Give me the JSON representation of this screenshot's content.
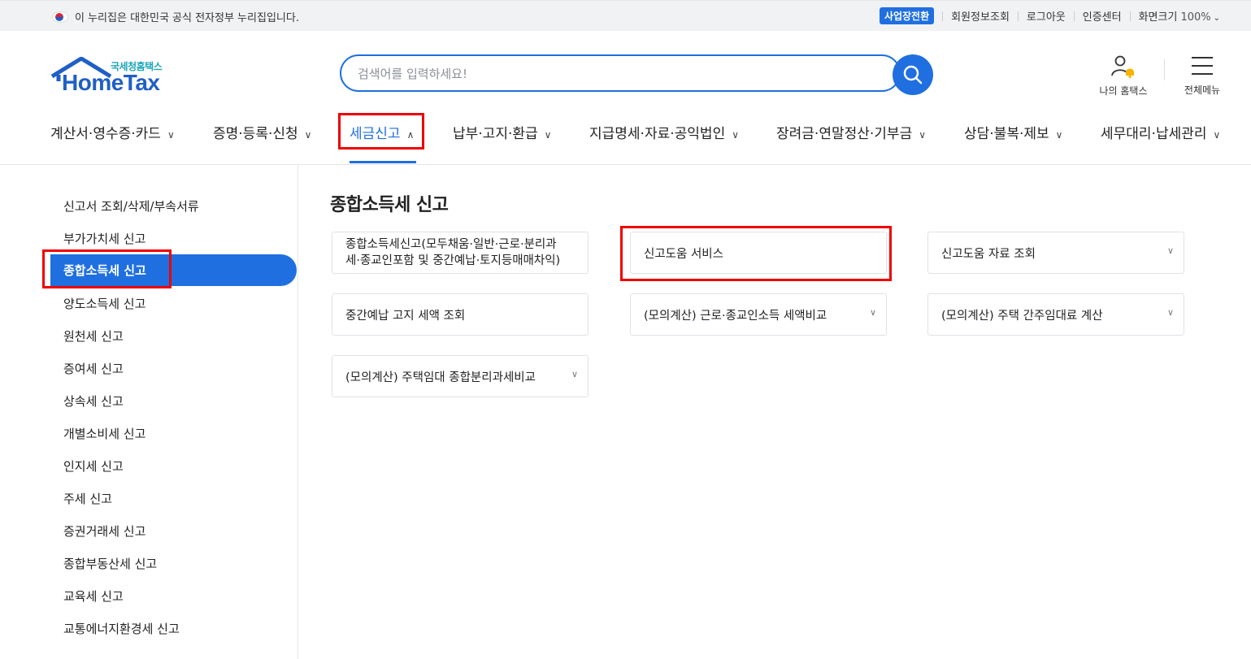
{
  "topbar": {
    "gov_text": "이 누리집은 대한민국 공식 전자정부 누리집입니다.",
    "biz_switch": "사업장전환",
    "member_info": "회원정보조회",
    "logout": "로그아웃",
    "cert_center": "인증센터",
    "zoom_label": "화면크기",
    "zoom_value": "100%"
  },
  "logo": {
    "korean": "국세청홈택스",
    "english": "HomeTax"
  },
  "search": {
    "placeholder": "검색어를 입력하세요!"
  },
  "header": {
    "my_hometax": "나의 홈택스",
    "all_menu": "전체메뉴"
  },
  "gnb": [
    {
      "label": "계산서·영수증·카드"
    },
    {
      "label": "증명·등록·신청"
    },
    {
      "label": "세금신고"
    },
    {
      "label": "납부·고지·환급"
    },
    {
      "label": "지급명세·자료·공익법인"
    },
    {
      "label": "장려금·연말정산·기부금"
    },
    {
      "label": "상담·불복·제보"
    },
    {
      "label": "세무대리·납세관리"
    }
  ],
  "sidebar": {
    "items": [
      {
        "label": "신고서 조회/삭제/부속서류"
      },
      {
        "label": "부가가치세 신고"
      },
      {
        "label": "종합소득세 신고"
      },
      {
        "label": "양도소득세 신고"
      },
      {
        "label": "원천세 신고"
      },
      {
        "label": "증여세 신고"
      },
      {
        "label": "상속세 신고"
      },
      {
        "label": "개별소비세 신고"
      },
      {
        "label": "인지세 신고"
      },
      {
        "label": "주세 신고"
      },
      {
        "label": "증권거래세 신고"
      },
      {
        "label": "종합부동산세 신고"
      },
      {
        "label": "교육세 신고"
      },
      {
        "label": "교통에너지환경세 신고"
      }
    ],
    "active_index": 2
  },
  "main": {
    "title": "종합소득세 신고",
    "cards": [
      {
        "line1": "종합소득세신고(모두채움·일반·근로·분리과",
        "line2": "세·종교인포함 및 중간예납·토지등매매차익)"
      },
      {
        "label": "신고도움 서비스"
      },
      {
        "label": "신고도움 자료 조회"
      },
      {
        "label": "중간예납 고지 세액 조회"
      },
      {
        "label": "(모의계산) 근로·종교인소득 세액비교"
      },
      {
        "label": "(모의계산) 주택 간주임대료 계산"
      },
      {
        "label": "(모의계산) 주택임대 종합분리과세비교"
      }
    ]
  },
  "colors": {
    "accent": "#1f6fe0",
    "highlight": "#e00000",
    "brand_teal": "#1aa6b7"
  }
}
